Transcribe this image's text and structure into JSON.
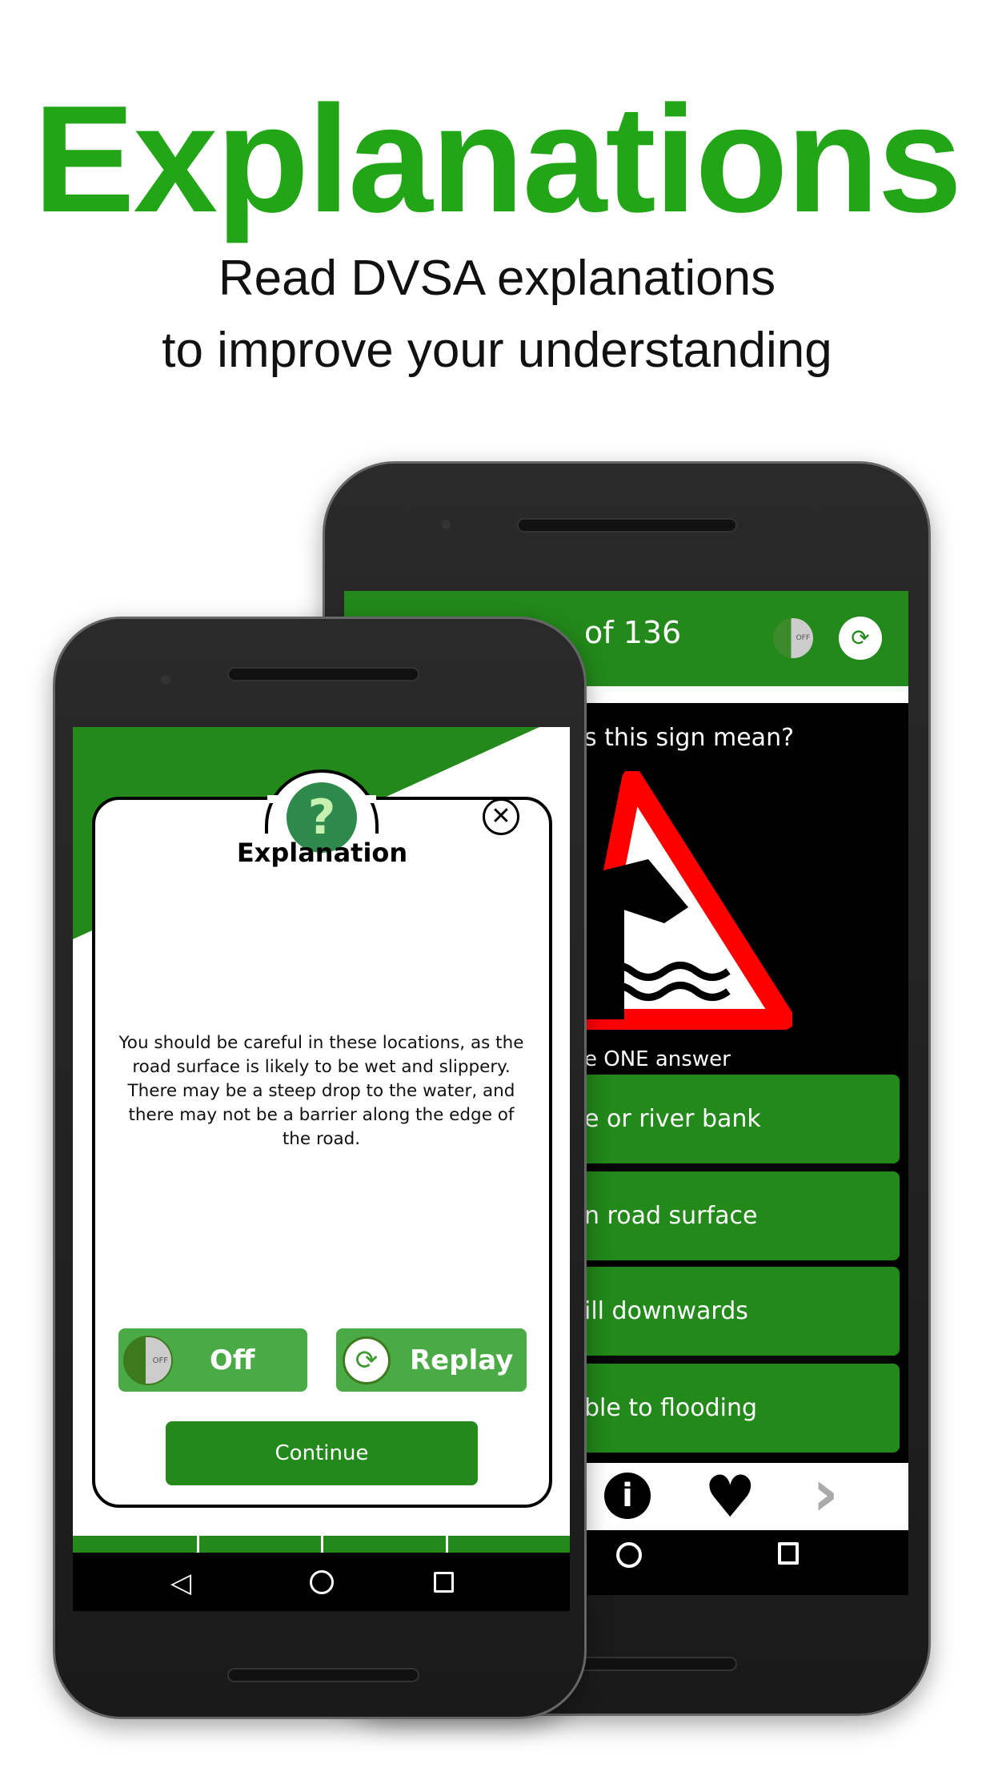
{
  "headline": "Explanations",
  "subtitle": [
    "Read DVSA explanations",
    "to improve your understanding"
  ],
  "back_screen": {
    "counter": "of 136",
    "question": "s this sign mean?",
    "instruction": "e ONE answer",
    "answers": [
      "e or river bank",
      "n road surface",
      "ill downwards",
      "ble to flooding"
    ],
    "toolbar_icons": [
      "info-icon",
      "heart-icon",
      "next-chevron-icon"
    ],
    "header_icons": [
      "voice-off-icon",
      "replay-icon"
    ]
  },
  "dialog": {
    "title": "Explanation",
    "body": "You should be careful in these locations, as the road surface is likely to be wet and slippery. There may be a steep drop to the water, and there may not be a barrier along the edge of the road.",
    "voice_button": "Off",
    "voice_badge": "OFF",
    "replay_button": "Replay",
    "continue_button": "Continue"
  },
  "colors": {
    "brand_green": "#22a618",
    "app_green": "#22891a",
    "button_green": "#4aaa46"
  }
}
